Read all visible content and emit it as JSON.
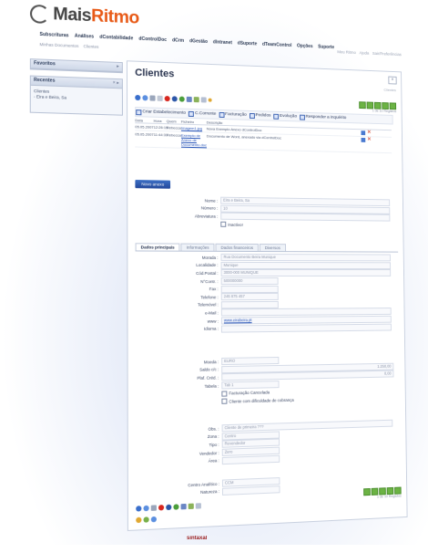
{
  "brand": {
    "name_a": "Mais",
    "name_b": "Ritmo"
  },
  "topnav": [
    "Subscrituras",
    "Análises",
    "dContabilidade",
    "dControlDoc",
    "dCrm",
    "dGestão",
    "dIntranet",
    "dSuporte",
    "dTeamControl",
    "Opções",
    "Suporte"
  ],
  "subnav": [
    "Minhas Documentos",
    "Clientes"
  ],
  "userlinks": [
    "Meu Ritmo",
    "Ajuda",
    "Sair/Preferências"
  ],
  "sidebar": {
    "favoritos": {
      "title": "Favoritos",
      "icon": "▸"
    },
    "recentes": {
      "title": "Recentes",
      "icon": "× ▸",
      "items": [
        "Clientes",
        "- Eira e Beira, Sa"
      ]
    }
  },
  "main": {
    "title": "Clientes",
    "close": "×",
    "breadcrumb": "Clientes",
    "pager_label": "1 de 10 Registos",
    "actions": [
      "Criar Estabelecimento",
      "C.Corrente",
      "Facturação",
      "Pedidos",
      "Evolução",
      "Responder a inquérito"
    ],
    "history": {
      "headers": [
        "Data",
        "Hora",
        "Quem",
        "Ficheiro",
        "Descrição"
      ],
      "rows": [
        {
          "date": "05.05.2007",
          "time": "12:26:15",
          "who": "Rebecca",
          "file": "Imagem1.jpg",
          "desc": "Nova Exemplo Anexo dControlDoc"
        },
        {
          "date": "05.05.2007",
          "time": "11:44:31",
          "who": "Rebecca",
          "file": "Exemplo de Anexo de Documento.doc",
          "desc": "Documento de Word, anexado via dControlDoc"
        }
      ]
    },
    "new_button": "Novo anexo",
    "top_fields": [
      {
        "label": "Nome :",
        "value": "Eira e Beira, Sa"
      },
      {
        "label": "Número :",
        "value": "10"
      },
      {
        "label": "Abreviatura :",
        "value": ""
      }
    ],
    "inactive_label": "Inactivo!",
    "tabs": [
      "Dados principais",
      "Informações",
      "Dados financeiros",
      "Diversos"
    ],
    "main_fields": [
      {
        "label": "Morada :",
        "value": "Rua Documento Beira Munique"
      },
      {
        "label": "Localidade :",
        "value": "Munique"
      },
      {
        "label": "Cód.Postal :",
        "value": "3000-000 MUNIQUE"
      },
      {
        "label": "N°Contr. :",
        "value": "500000000"
      },
      {
        "label": "Fax :",
        "value": ""
      },
      {
        "label": "Telefone :",
        "value": "245 875 457"
      },
      {
        "label": "Telemóvel :",
        "value": ""
      },
      {
        "label": "e-Mail :",
        "value": ""
      },
      {
        "label": "www :",
        "value": "www.eirabeira.pt"
      },
      {
        "label": "Idioma :",
        "value": ""
      }
    ],
    "finance_fields": [
      {
        "label": "Moeda :",
        "value": "EURO"
      },
      {
        "label": "Saldo c/c :",
        "value": "1.250,00"
      },
      {
        "label": "Plaf. Créd. :",
        "value": "0,00"
      },
      {
        "label": "Tabela :",
        "value": "Tab 1"
      }
    ],
    "checkboxes": [
      "Facturação Cancelada",
      "Cliente com dificuldade de cobrança"
    ],
    "other_fields": [
      {
        "label": "Obs. :",
        "value": "Cliente de primeira ??? "
      },
      {
        "label": "Zona :",
        "value": "Centro"
      },
      {
        "label": "Tipo :",
        "value": "Revendedor"
      },
      {
        "label": "Vendedor :",
        "value": "Zero"
      },
      {
        "label": "Área :",
        "value": ""
      }
    ],
    "analytic_fields": [
      {
        "label": "Centro Analítico :",
        "value": "CCM"
      },
      {
        "label": "Natureza :",
        "value": ""
      }
    ]
  },
  "footer": "sintaxal"
}
